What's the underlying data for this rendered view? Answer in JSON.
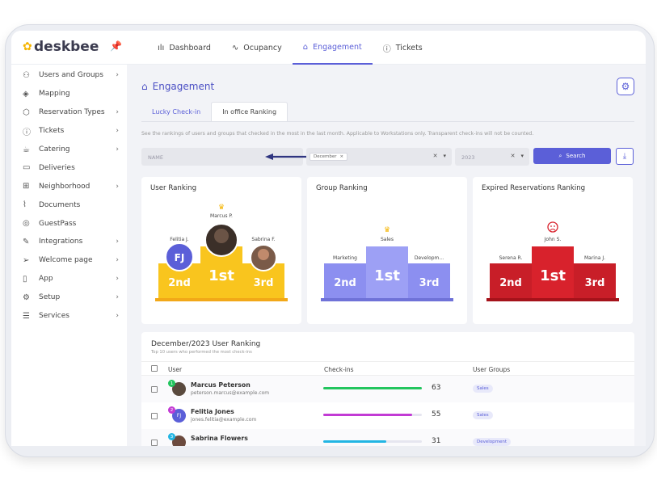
{
  "app": {
    "logo_text": "deskbee",
    "accent": "#5b5fd8"
  },
  "nav": [
    {
      "label": "Dashboard",
      "icon": "bar-chart-icon"
    },
    {
      "label": "Ocupancy",
      "icon": "activity-icon"
    },
    {
      "label": "Engagement",
      "icon": "gift-icon",
      "active": true
    },
    {
      "label": "Tickets",
      "icon": "info-icon"
    }
  ],
  "sidebar": {
    "items": [
      {
        "label": "Users and Groups",
        "icon": "users-icon",
        "has_children": true
      },
      {
        "label": "Mapping",
        "icon": "layers-icon",
        "has_children": false
      },
      {
        "label": "Reservation Types",
        "icon": "cube-icon",
        "has_children": true
      },
      {
        "label": "Tickets",
        "icon": "info-icon",
        "has_children": true
      },
      {
        "label": "Catering",
        "icon": "cup-icon",
        "has_children": true
      },
      {
        "label": "Deliveries",
        "icon": "box-icon",
        "has_children": false
      },
      {
        "label": "Neighborhood",
        "icon": "grid-icon",
        "has_children": true
      },
      {
        "label": "Documents",
        "icon": "paperclip-icon",
        "has_children": false
      },
      {
        "label": "GuestPass",
        "icon": "location-icon",
        "has_children": false
      },
      {
        "label": "Integrations",
        "icon": "wrench-icon",
        "has_children": true
      },
      {
        "label": "Welcome page",
        "icon": "send-icon",
        "has_children": true
      },
      {
        "label": "App",
        "icon": "phone-icon",
        "has_children": true
      },
      {
        "label": "Setup",
        "icon": "settings-icon",
        "has_children": true
      },
      {
        "label": "Services",
        "icon": "server-icon",
        "has_children": true
      }
    ]
  },
  "page": {
    "title": "Engagement",
    "tabs": [
      "Lucky Check-in",
      "In office Ranking"
    ],
    "active_tab": 1,
    "description": "See the rankings of users and groups that checked in the most in the last month. Applicable to Workstations only. Transparent check-ins will not be counted."
  },
  "filters": {
    "name_placeholder": "NAME",
    "month_chip": "December",
    "year_value": "2023",
    "search_label": "Search"
  },
  "rankings": [
    {
      "title": "User Ranking",
      "color": "#f9c51e",
      "dark": "#f2a818",
      "first": "Marcus P.",
      "second": "Felitia J.",
      "third": "Sabrina F.",
      "second_initials": "FJ",
      "marker": "crown"
    },
    {
      "title": "Group Ranking",
      "color": "#8c8ff0",
      "dark": "#6f72d8",
      "first": "Sales",
      "second": "Marketing",
      "third": "Developm...",
      "marker": "crown"
    },
    {
      "title": "Expired Reservations Ranking",
      "color": "#d8222c",
      "dark": "#b3121b",
      "first": "John S.",
      "second": "Serena R.",
      "third": "Marina J.",
      "marker": "sad-face"
    }
  ],
  "podium_labels": {
    "first": "1st",
    "second": "2nd",
    "third": "3rd"
  },
  "leaderboard": {
    "title": "December/2023 User Ranking",
    "subtitle": "Top 10 users who performed the most check-ins",
    "headers": {
      "user": "User",
      "checkins": "Check-ins",
      "groups": "User Groups"
    },
    "rows": [
      {
        "rank": "1",
        "name": "Marcus Peterson",
        "email": "peterson.marcus@example.com",
        "checkins": 63,
        "fill": 1.0,
        "bar_color": "#22c55e",
        "group": "Sales",
        "dot_color": "#22c55e",
        "avatar_color": "#5a4a3e"
      },
      {
        "rank": "2",
        "name": "Felitia Jones",
        "email": "jones.felitia@example.com",
        "checkins": 55,
        "fill": 0.9,
        "bar_color": "#c23bd4",
        "group": "Sales",
        "dot_color": "#c23bd4",
        "avatar_color": "#5b5fd8",
        "initials": "FJ"
      },
      {
        "rank": "3",
        "name": "Sabrina Flowers",
        "email": "",
        "checkins": 31,
        "fill": 0.64,
        "bar_color": "#22b5e3",
        "group": "Development",
        "dot_color": "#22b5e3",
        "avatar_color": "#6b4a3e"
      }
    ]
  }
}
